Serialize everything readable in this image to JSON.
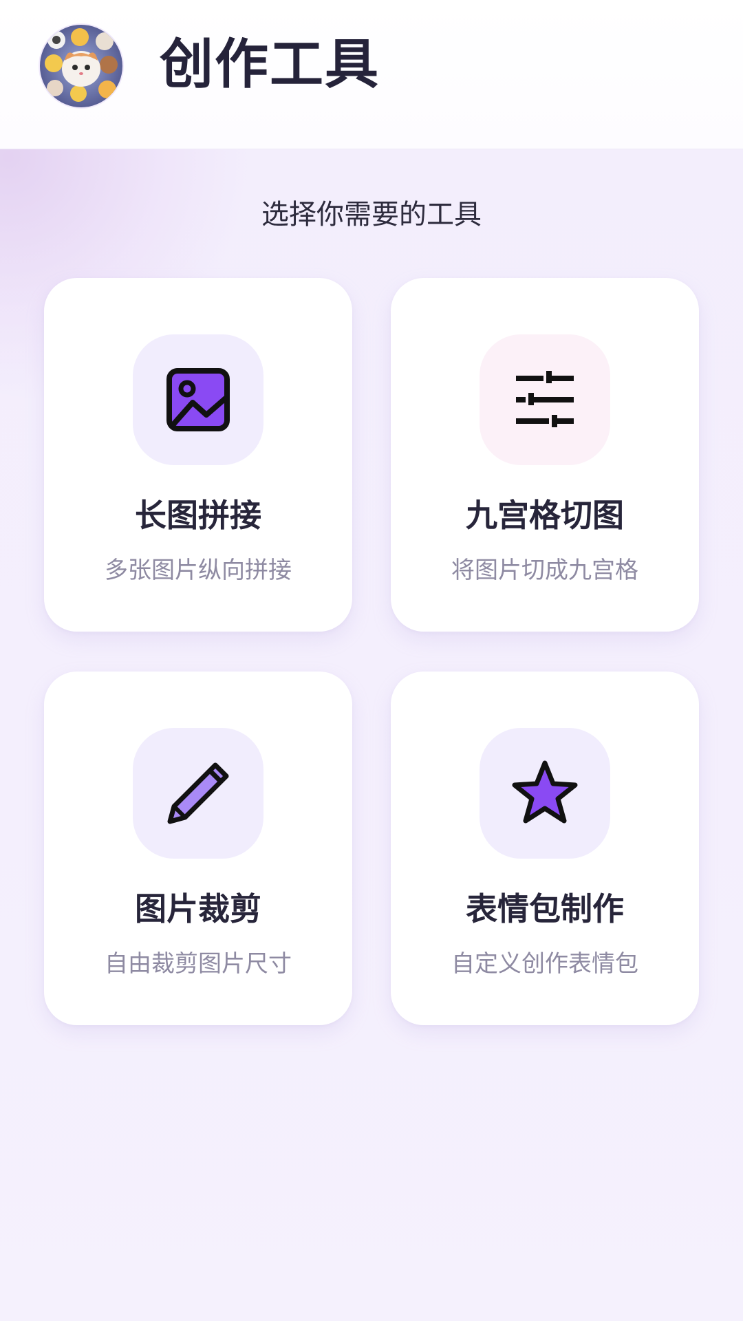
{
  "header": {
    "title": "创作工具",
    "avatar_icon": "cat-emoji-collage-avatar"
  },
  "subtitle": "选择你需要的工具",
  "colors": {
    "accent": "#8a4af3",
    "accent_light": "#a98af6",
    "icon_bg": "#f1edfd",
    "icon_bg_pink": "#fcf1f8",
    "title_text": "#27253a",
    "desc_text": "#8e8aa2",
    "page_bg": "#f4effd"
  },
  "tools": [
    {
      "title": "长图拼接",
      "desc": "多张图片纵向拼接",
      "icon": "image-icon"
    },
    {
      "title": "九宫格切图",
      "desc": "将图片切成九宫格",
      "icon": "sliders-icon"
    },
    {
      "title": "图片裁剪",
      "desc": "自由裁剪图片尺寸",
      "icon": "pencil-icon"
    },
    {
      "title": "表情包制作",
      "desc": "自定义创作表情包",
      "icon": "star-icon"
    }
  ]
}
